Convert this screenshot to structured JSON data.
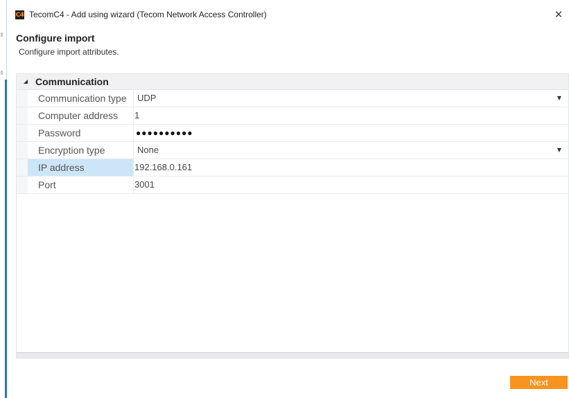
{
  "window": {
    "title": "TecomC4 - Add using wizard (Tecom Network Access Controller)",
    "app_icon_text": "C4",
    "close_glyph": "✕"
  },
  "header": {
    "title": "Configure import",
    "subtitle": "Configure import attributes."
  },
  "grid": {
    "category": {
      "label": "Communication",
      "toggle_glyph": "◢",
      "expanded": true
    },
    "rows": [
      {
        "name": "Communication type",
        "value": "UDP",
        "has_dropdown": true
      },
      {
        "name": "Computer address",
        "value": "1",
        "has_dropdown": false
      },
      {
        "name": "Password",
        "value": "●●●●●●●●●●",
        "has_dropdown": false
      },
      {
        "name": "Encryption type",
        "value": "None",
        "has_dropdown": true
      },
      {
        "name": "IP address",
        "value": "192.168.0.161",
        "has_dropdown": false,
        "selected": true
      },
      {
        "name": "Port",
        "value": "3001",
        "has_dropdown": false
      }
    ],
    "dropdown_glyph": "▼"
  },
  "footer": {
    "next_label": "Next"
  },
  "colors": {
    "accent_orange": "#f7931e",
    "selected_blue": "#cde6f7",
    "left_bar_blue": "#2a6fd1"
  }
}
